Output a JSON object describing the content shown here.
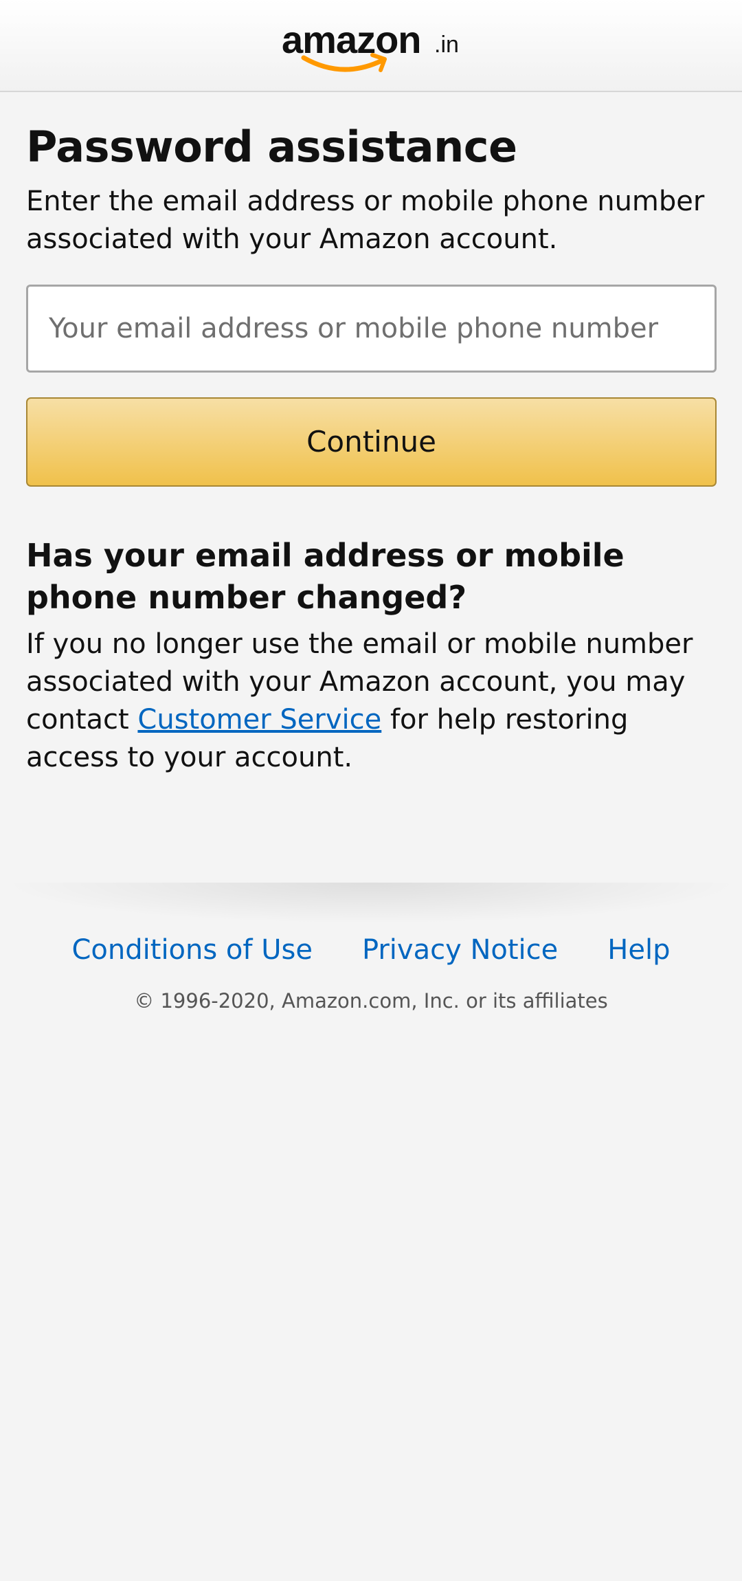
{
  "header": {
    "logo_text": "amazon",
    "logo_tld": ".in",
    "logo_smile_color": "#f90"
  },
  "main": {
    "title": "Password assistance",
    "intro": "Enter the email address or mobile phone number associated with your Amazon account.",
    "email_input": {
      "value": "",
      "placeholder": "Your email address or mobile phone number"
    },
    "continue_label": "Continue",
    "changed_heading": "Has your email address or mobile phone number changed?",
    "changed_text_before": "If you no longer use the email or mobile number associated with your Amazon account, you may contact ",
    "changed_link": "Customer Service",
    "changed_text_after": " for help restoring access to your account."
  },
  "footer": {
    "links": [
      "Conditions of Use",
      "Privacy Notice",
      "Help"
    ],
    "copyright": "© 1996-2020, Amazon.com, Inc. or its affiliates"
  },
  "colors": {
    "link": "#0066c0",
    "button_top": "#f7dfa5",
    "button_bottom": "#f0c14b",
    "button_border": "#a88734",
    "background": "#f4f4f4"
  }
}
